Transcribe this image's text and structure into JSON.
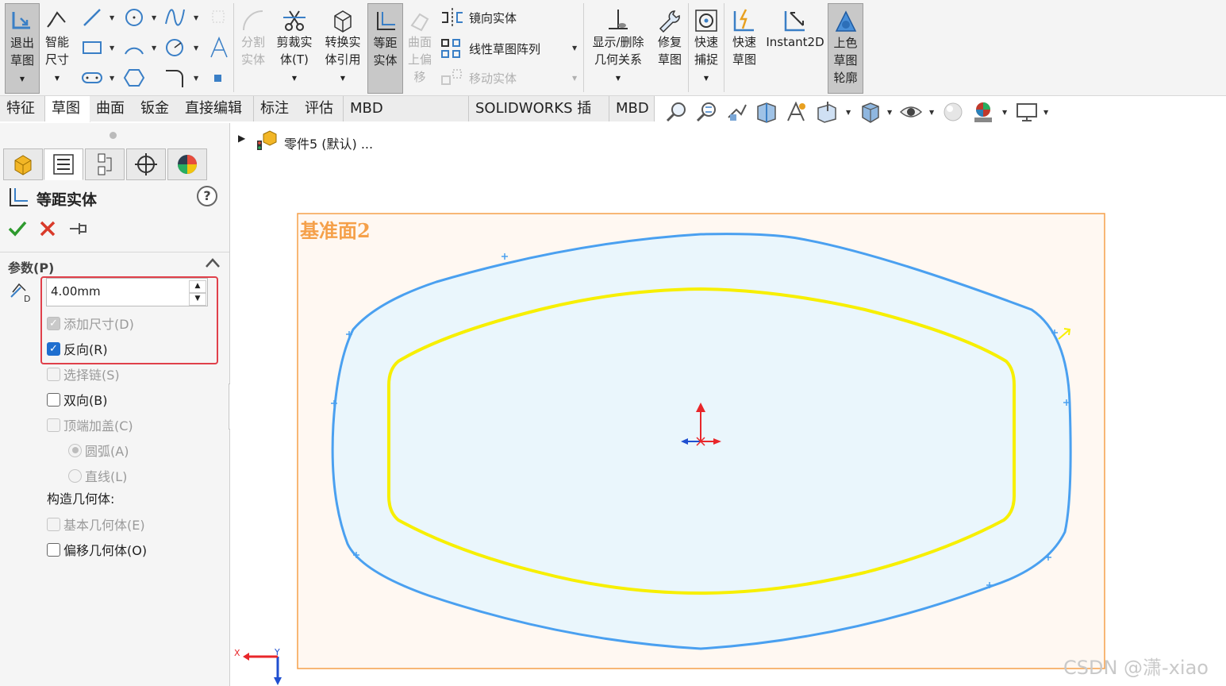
{
  "ribbon": {
    "exit_sketch": "退出\n草图",
    "smart_dim": "智能\n尺寸",
    "split": "分割\n实体",
    "trim": "剪裁实\n体(T)",
    "convert": "转换实\n体引用",
    "offset": "等距\n实体",
    "surface_offset": "曲面\n上偏\n移",
    "mirror": "镜向实体",
    "linear_pattern": "线性草图阵列",
    "move": "移动实体",
    "display_relations": "显示/删除\n几何关系",
    "repair": "修复\n草图",
    "quick_snap": "快速\n捕捉",
    "rapid_sketch": "快速\n草图",
    "instant2d": "Instant2D",
    "shaded_contours": "上色\n草图\n轮廓"
  },
  "tabs": [
    "特征",
    "草图",
    "曲面",
    "钣金",
    "直接编辑",
    "标注",
    "评估",
    "MBD Dimensions",
    "SOLIDWORKS 插件",
    "MBD"
  ],
  "panel": {
    "title": "等距实体",
    "help": "?",
    "params_header": "参数(P)",
    "distance_value": "4.00mm",
    "checkboxes": {
      "add_dims": "添加尺寸(D)",
      "reverse": "反向(R)",
      "select_chain": "选择链(S)",
      "bidirectional": "双向(B)",
      "cap_ends": "顶端加盖(C)",
      "arcs": "圆弧(A)",
      "lines": "直线(L)",
      "construction_label": "构造几何体:",
      "base_geometry": "基本几何体(E)",
      "offset_geometry": "偏移几何体(O)"
    }
  },
  "tree": {
    "part_name": "零件5 (默认) ..."
  },
  "canvas": {
    "plane_label": "基准面2",
    "watermark": "CSDN @潇-xiao"
  },
  "colors": {
    "plane_border": "#f5a04a",
    "plane_fill": "#fff8f2",
    "original_sketch": "#4aa0f0",
    "offset_sketch": "#f7ef00",
    "highlight_box": "#e0404a"
  }
}
